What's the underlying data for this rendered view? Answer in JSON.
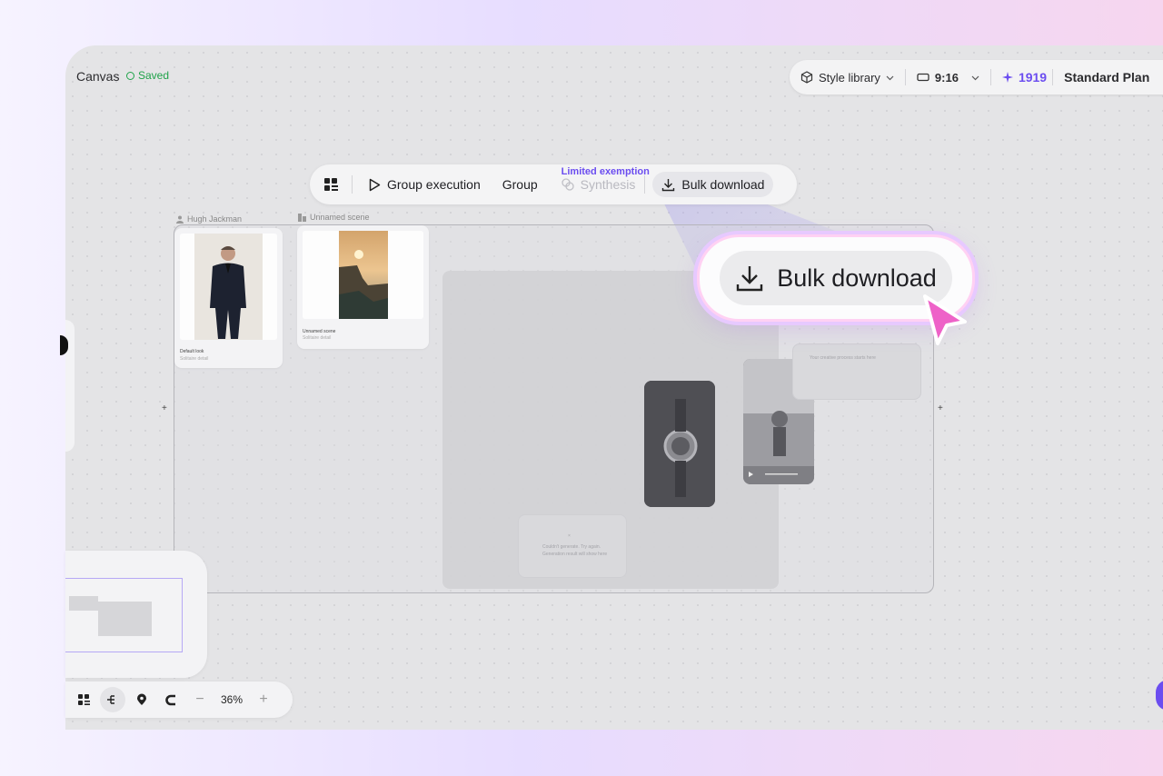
{
  "canvas": {
    "title": "Canvas",
    "saved_label": "Saved"
  },
  "topbar": {
    "style_library": "Style library",
    "ratio": "9:16",
    "credits": "1919",
    "plan": "Standard Plan"
  },
  "toolbar": {
    "group_execution": "Group execution",
    "group": "Group",
    "limited_tag": "Limited exemption",
    "synthesis": "Synthesis",
    "bulk_download": "Bulk download"
  },
  "nodes": {
    "character_label": "Hugh Jackman",
    "scene_label": "Unnamed scene",
    "character_card": {
      "title": "Default look",
      "subtitle": "Solitaire detail"
    },
    "scene_card": {
      "title": "Unnamed scene",
      "subtitle": "Solitaire detail"
    },
    "ghost_text_1": "Your creative process starts here",
    "ghost_text_2": "Couldn't generate. Try again.",
    "ghost_text_3": "Generation result will show here"
  },
  "callout": {
    "label": "Bulk download"
  },
  "zoom": {
    "level": "36%",
    "minus": "−",
    "plus": "+"
  },
  "colors": {
    "accent": "#6b4df0",
    "saved": "#1fa34a",
    "callout_glow": "#e7c9ff",
    "cursor": "#ee62c8"
  }
}
